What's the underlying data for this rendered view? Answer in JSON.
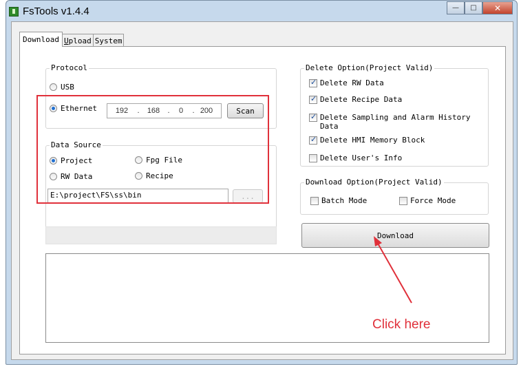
{
  "window": {
    "title": "FsTools v1.4.4"
  },
  "tabs": [
    {
      "label": "Download",
      "underline": ""
    },
    {
      "label": "pload",
      "underline": "U"
    },
    {
      "label": "System",
      "underline": ""
    }
  ],
  "protocol": {
    "legend": "Protocol",
    "usb_label": "USB",
    "ethernet_label": "Ethernet",
    "selected": "Ethernet",
    "ip": [
      "192",
      "168",
      "0",
      "200"
    ],
    "scan_label": "Scan"
  },
  "data_source": {
    "legend": "Data Source",
    "project_label": "Project",
    "fpg_label": "Fpg File",
    "rw_label": "RW Data",
    "recipe_label": "Recipe",
    "selected": "Project",
    "path": "E:\\project\\FS\\ss\\bin",
    "browse_label": "..."
  },
  "delete_option": {
    "legend": "Delete Option(Project Valid)",
    "items": [
      {
        "label": "Delete RW Data",
        "checked": true
      },
      {
        "label": "Delete Recipe Data",
        "checked": true
      },
      {
        "label": "Delete Sampling and Alarm History Data",
        "checked": true
      },
      {
        "label": "Delete HMI Memory Block",
        "checked": true
      },
      {
        "label": "Delete User's Info",
        "checked": false
      }
    ]
  },
  "download_option": {
    "legend": "Download Option(Project Valid)",
    "batch_label": "Batch Mode",
    "force_label": "Force Mode",
    "batch_checked": false,
    "force_checked": false
  },
  "download_button": "Download",
  "annotation": {
    "text": "Click here",
    "color": "#e0303a"
  }
}
